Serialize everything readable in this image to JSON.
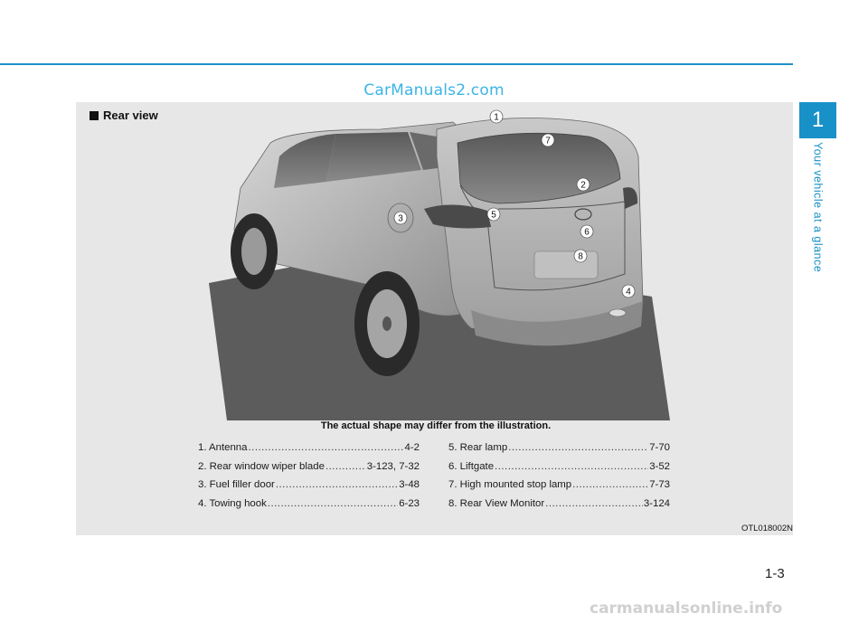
{
  "watermark_top": "CarManuals2.com",
  "section": {
    "title": "Rear view"
  },
  "illustration": {
    "callouts": [
      "1",
      "7",
      "2",
      "3",
      "5",
      "6",
      "8",
      "4"
    ],
    "caption": "The actual shape may differ from the illustration."
  },
  "legend": {
    "left": [
      {
        "label": "1. Antenna",
        "page": "4-2"
      },
      {
        "label": "2. Rear window wiper blade",
        "page": "3-123, 7-32"
      },
      {
        "label": "3. Fuel filler door",
        "page": "3-48"
      },
      {
        "label": "4. Towing hook",
        "page": "6-23"
      }
    ],
    "right": [
      {
        "label": "5. Rear lamp",
        "page": "7-70"
      },
      {
        "label": "6. Liftgate",
        "page": "3-52"
      },
      {
        "label": "7. High mounted stop lamp",
        "page": "7-73"
      },
      {
        "label": "8. Rear View Monitor",
        "page": "3-124"
      }
    ]
  },
  "figure_code": "OTL018002N",
  "chapter": {
    "number": "1",
    "name": "Your vehicle at a glance"
  },
  "page_number": "1-3",
  "footer_watermark": "carmanualsonline.info",
  "colors": {
    "accent": "#1891c9",
    "panel": "#e7e7e7",
    "watermark": "#3cb4e6"
  }
}
